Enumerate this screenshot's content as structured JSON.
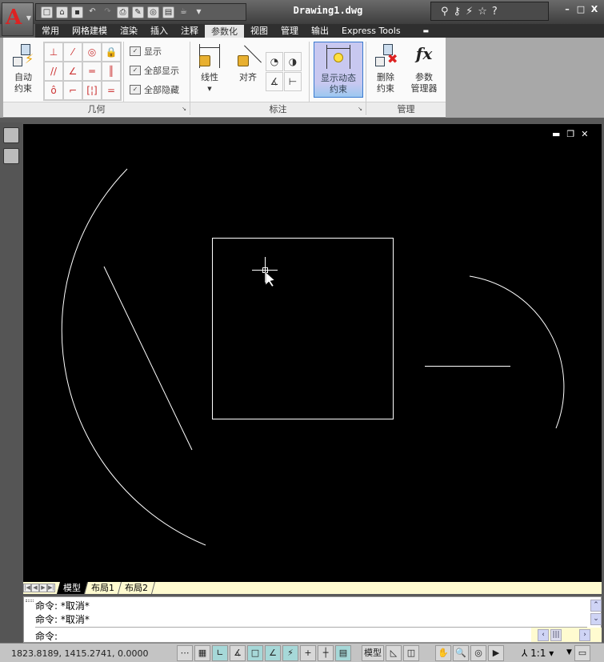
{
  "title": "Drawing1.dwg",
  "app_menu": {
    "icon": "autocad-logo-icon",
    "letter": "A"
  },
  "quick_access": [
    "new-icon",
    "open-icon",
    "save-icon",
    "undo-icon",
    "redo-icon",
    "plot-icon",
    "publish-icon",
    "preview-icon",
    "properties-icon",
    "workspace-icon"
  ],
  "tabs": [
    "常用",
    "网格建模",
    "渲染",
    "插入",
    "注释",
    "参数化",
    "视图",
    "管理",
    "输出",
    "Express Tools"
  ],
  "active_tab": "参数化",
  "ribbon": {
    "geometry": {
      "title": "几何",
      "auto_constrain": "自动\n约束",
      "auto_constrain_l1": "自动",
      "auto_constrain_l2": "约束",
      "show": "显示",
      "show_all": "全部显示",
      "hide_all": "全部隐藏"
    },
    "dimension": {
      "title": "标注",
      "linear": "线性",
      "aligned": "对齐",
      "show_dynamic_l1": "显示动态",
      "show_dynamic_l2": "约束"
    },
    "manage": {
      "title": "管理",
      "delete_l1": "删除",
      "delete_l2": "约束",
      "params_l1": "参数",
      "params_l2": "管理器",
      "fx": "fx"
    }
  },
  "layout_tabs": [
    "模型",
    "布局1",
    "布局2"
  ],
  "active_layout": "模型",
  "command_history": [
    "命令: *取消*",
    "命令: *取消*"
  ],
  "command_prompt": "命令:",
  "status": {
    "coords": "1823.8189, 1415.2741, 0.0000",
    "model": "模型",
    "scale": "1:1"
  },
  "colors": {
    "canvas": "#000000",
    "geometry": "#ffffff",
    "ribbon_active": "#c8c8f0"
  }
}
